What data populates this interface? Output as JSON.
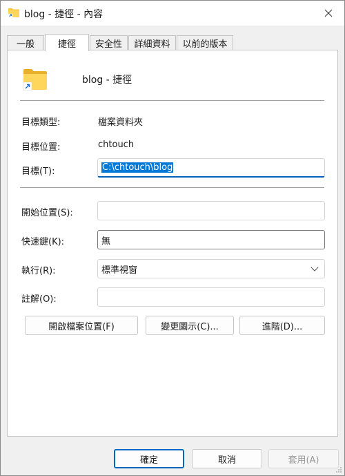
{
  "window": {
    "title": "blog - 捷徑 - 內容"
  },
  "tabs": [
    {
      "label": "一般"
    },
    {
      "label": "捷徑"
    },
    {
      "label": "安全性"
    },
    {
      "label": "詳細資料"
    },
    {
      "label": "以前的版本"
    }
  ],
  "header": {
    "name": "blog - 捷徑"
  },
  "fields": {
    "target_type": {
      "label": "目標類型:",
      "value": "檔案資料夾"
    },
    "target_location": {
      "label": "目標位置:",
      "value": "chtouch"
    },
    "target": {
      "label": "目標(T):",
      "value": "C:\\chtouch\\blog"
    },
    "start_in": {
      "label": "開始位置(S):",
      "value": ""
    },
    "shortcut_key": {
      "label": "快速鍵(K):",
      "value": "無"
    },
    "run": {
      "label": "執行(R):",
      "value": "標準視窗"
    },
    "comment": {
      "label": "註解(O):",
      "value": ""
    }
  },
  "action_buttons": {
    "open_location": "開啟檔案位置(F)",
    "change_icon": "變更圖示(C)...",
    "advanced": "進階(D)..."
  },
  "footer": {
    "ok": "確定",
    "cancel": "取消",
    "apply": "套用(A)"
  },
  "colors": {
    "accent": "#005fb8",
    "selection": "#0078d7",
    "folder": "#f8c93f"
  }
}
